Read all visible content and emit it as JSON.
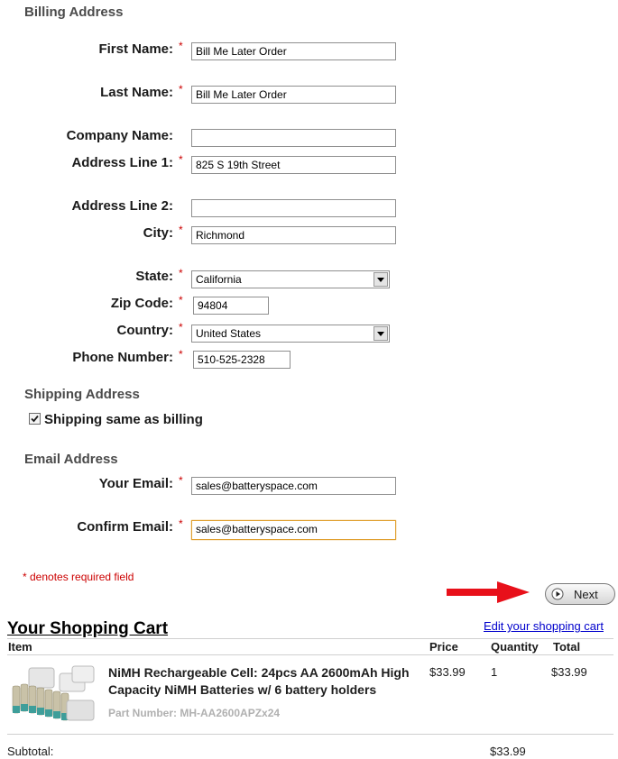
{
  "billing": {
    "title": "Billing Address",
    "first_name": {
      "label": "First Name:",
      "value": "Bill Me Later Order"
    },
    "last_name": {
      "label": "Last Name:",
      "value": "Bill Me Later Order"
    },
    "company": {
      "label": "Company Name:",
      "value": ""
    },
    "address1": {
      "label": "Address Line 1:",
      "value": "825 S 19th Street"
    },
    "address2": {
      "label": "Address Line 2:",
      "value": ""
    },
    "city": {
      "label": "City:",
      "value": "Richmond"
    },
    "state": {
      "label": "State:",
      "value": "California"
    },
    "zip": {
      "label": "Zip Code:",
      "value": "94804"
    },
    "country": {
      "label": "Country:",
      "value": "United States"
    },
    "phone": {
      "label": "Phone Number:",
      "value": "510-525-2328"
    },
    "required_mark": "*"
  },
  "shipping": {
    "title": "Shipping Address",
    "same_label": "Shipping same as billing",
    "same_checked": true
  },
  "email": {
    "title": "Email Address",
    "your_email": {
      "label": "Your Email:",
      "value": "sales@batteryspace.com"
    },
    "confirm_email": {
      "label": "Confirm Email:",
      "value": "sales@batteryspace.com"
    }
  },
  "required_note": "* denotes required field",
  "next_button": {
    "label": "Next"
  },
  "cart": {
    "title": "Your Shopping Cart",
    "edit_link": "Edit your shopping cart",
    "columns": {
      "item": "Item",
      "price": "Price",
      "quantity": "Quantity",
      "total": "Total"
    },
    "items": [
      {
        "name": "NiMH Rechargeable Cell: 24pcs AA 2600mAh High Capacity NiMH Batteries w/ 6 battery holders",
        "part_number": "Part Number: MH-AA2600APZx24",
        "price": "$33.99",
        "quantity": "1",
        "total": "$33.99"
      }
    ],
    "subtotal_label": "Subtotal:",
    "subtotal_value": "$33.99"
  },
  "colors": {
    "required": "#cc0000",
    "focus_border": "#e0a030",
    "link": "#0000cc",
    "arrow": "#e8101a"
  }
}
